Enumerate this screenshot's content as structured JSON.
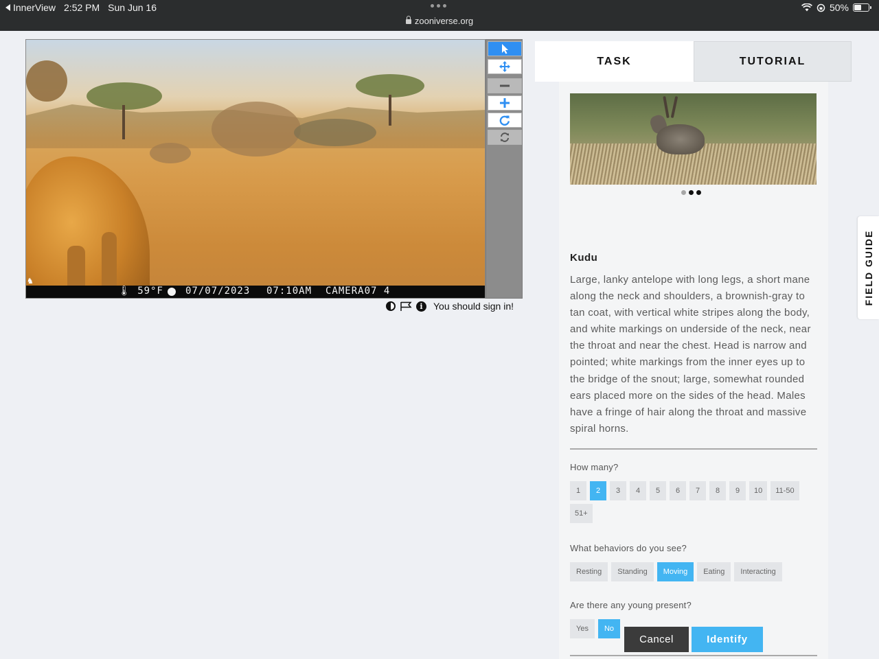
{
  "statusbar": {
    "back_app": "InnerView",
    "time": "2:52 PM",
    "date": "Sun Jun 16",
    "url": "zooniverse.org",
    "battery": "50%"
  },
  "camera": {
    "temperature": "59°F",
    "date": "07/07/2023",
    "time": "07:10AM",
    "camera_id": "CAMERA07 4"
  },
  "toolbar": {
    "tools": [
      "pointer-icon",
      "move-icon",
      "zoom-out-icon",
      "zoom-in-icon",
      "rotate-icon",
      "reset-icon"
    ]
  },
  "meta": {
    "sign_in_text": "You should sign in!"
  },
  "tabs": {
    "task": "TASK",
    "tutorial": "TUTORIAL"
  },
  "species": {
    "name": "Kudu",
    "description": "Large, lanky antelope with long legs, a short mane along the neck and shoulders, a brownish-gray to tan coat, with vertical white stripes along the body, and white markings on underside of the neck, near the throat and near the chest. Head is narrow and pointed; white markings from the inner eyes up to the bridge of the snout; large, somewhat rounded ears placed more on the sides of the head. Males have a fringe of hair along the throat and massive spiral horns."
  },
  "questions": {
    "how_many": {
      "label": "How many?",
      "options": [
        "1",
        "2",
        "3",
        "4",
        "5",
        "6",
        "7",
        "8",
        "9",
        "10",
        "11-50",
        "51+"
      ],
      "selected": "2"
    },
    "behaviors": {
      "label": "What behaviors do you see?",
      "options": [
        "Resting",
        "Standing",
        "Moving",
        "Eating",
        "Interacting"
      ],
      "selected": "Moving"
    },
    "young": {
      "label": "Are there any young present?",
      "options": [
        "Yes",
        "No"
      ],
      "selected": "No"
    }
  },
  "actions": {
    "cancel": "Cancel",
    "identify": "Identify"
  },
  "field_guide": "FIELD GUIDE",
  "colors": {
    "accent": "#43b5f2",
    "tool_active": "#2f8ff2",
    "cancel": "#3b3b3b"
  }
}
